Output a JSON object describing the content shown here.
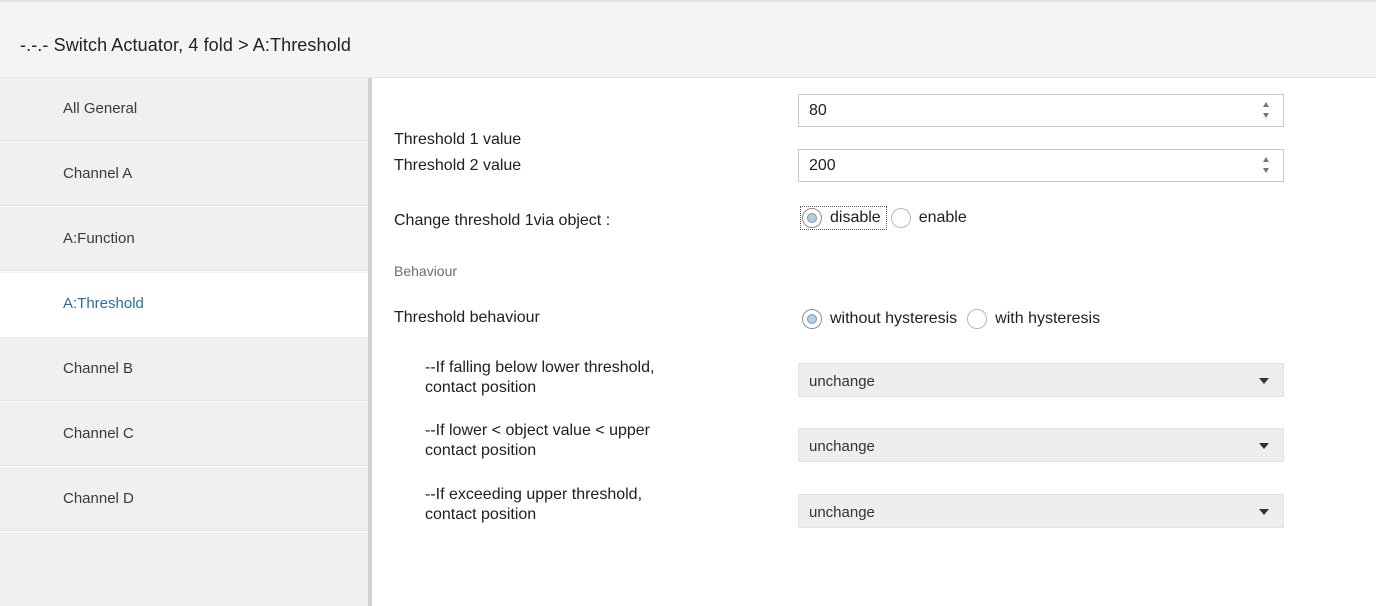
{
  "header": {
    "title": "-.-.- Switch Actuator, 4 fold > A:Threshold"
  },
  "sidebar": {
    "items": [
      {
        "label": "All General",
        "active": false
      },
      {
        "label": "Channel A",
        "active": false
      },
      {
        "label": "A:Function",
        "active": false
      },
      {
        "label": "A:Threshold",
        "active": true
      },
      {
        "label": "Channel B",
        "active": false
      },
      {
        "label": "Channel C",
        "active": false
      },
      {
        "label": "Channel D",
        "active": false
      }
    ]
  },
  "main": {
    "threshold1": {
      "label": "Threshold 1 value",
      "value": "80"
    },
    "threshold2": {
      "label": "Threshold 2 value",
      "value": "200"
    },
    "change_threshold": {
      "label": "Change threshold 1via object :",
      "options": [
        "disable",
        "enable"
      ],
      "selected": "disable"
    },
    "section": {
      "label": "Behaviour"
    },
    "threshold_behaviour": {
      "label": "Threshold behaviour",
      "options": [
        "without hysteresis",
        "with hysteresis"
      ],
      "selected": "without hysteresis"
    },
    "falling_below": {
      "label_line1": "--If falling below lower threshold,",
      "label_line2": "contact position",
      "value": "unchange"
    },
    "between": {
      "label_line1": "--If lower < object value < upper",
      "label_line2": "contact position",
      "value": "unchange"
    },
    "exceeding": {
      "label_line1": "--If exceeding upper threshold,",
      "label_line2": "contact position",
      "value": "unchange"
    }
  },
  "colors": {
    "accent": "#2b6ca8",
    "sidebar_bg": "#f0f0f0",
    "dropdown_bg": "#eeeeee"
  }
}
